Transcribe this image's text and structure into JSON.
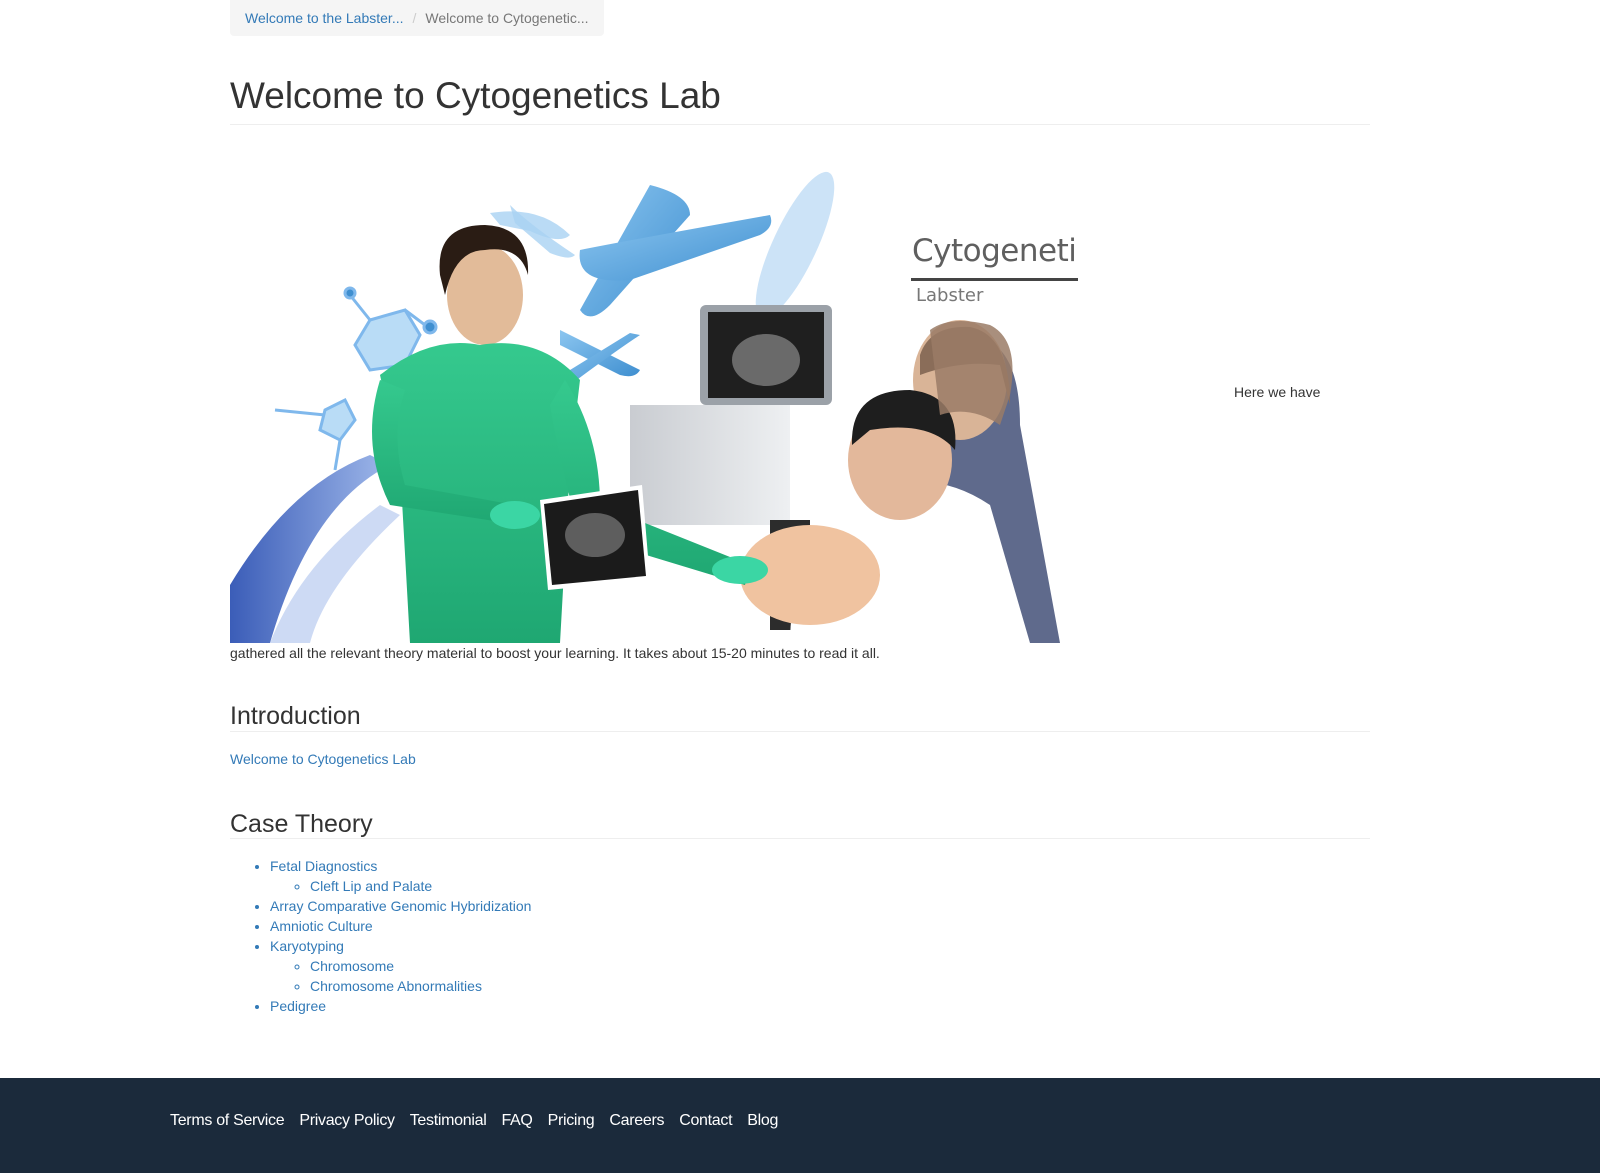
{
  "breadcrumb": {
    "items": [
      {
        "label": "Welcome to the Labster..."
      },
      {
        "label": "Welcome to Cytogenetic..."
      }
    ],
    "separator": "/"
  },
  "page": {
    "title": "Welcome to Cytogenetics Lab"
  },
  "hero": {
    "title": "Cytogenetics Lab",
    "subtitle": "Labster"
  },
  "intro_text": {
    "part1": "Here we have",
    "part2": "gathered all the relevant theory material to boost your learning. It takes about 15-20 minutes to read it all."
  },
  "sections": {
    "introduction": {
      "heading": "Introduction",
      "link": "Welcome to Cytogenetics Lab"
    },
    "case_theory": {
      "heading": "Case Theory",
      "items": [
        {
          "label": "Fetal Diagnostics",
          "children": [
            {
              "label": "Cleft Lip and Palate"
            }
          ]
        },
        {
          "label": "Array Comparative Genomic Hybridization"
        },
        {
          "label": "Amniotic Culture"
        },
        {
          "label": "Karyotyping",
          "children": [
            {
              "label": "Chromosome"
            },
            {
              "label": "Chromosome Abnormalities"
            }
          ]
        },
        {
          "label": "Pedigree"
        }
      ]
    }
  },
  "footer": {
    "links": [
      "Terms of Service",
      "Privacy Policy",
      "Testimonial",
      "FAQ",
      "Pricing",
      "Careers",
      "Contact",
      "Blog"
    ]
  },
  "colors": {
    "link": "#337ab7",
    "footer_bg": "#1b2a3b",
    "scrubs": "#2fbf86",
    "chromosome": "#5aa7e0"
  }
}
